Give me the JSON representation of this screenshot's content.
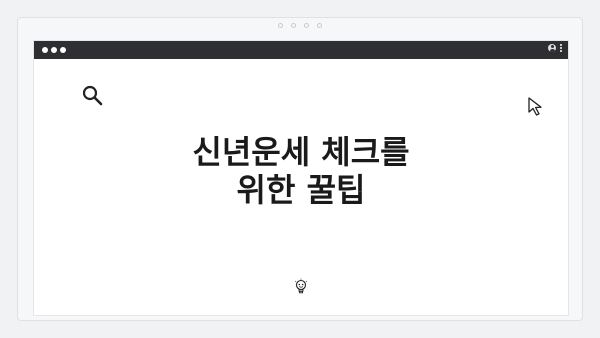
{
  "headline": {
    "line1": "신년운세 체크를",
    "line2": "위한 꿀팁"
  },
  "icons": {
    "search": "search-icon",
    "cursor": "cursor-arrow-icon",
    "lightbulb": "lightbulb-icon",
    "user": "user-icon",
    "menu": "more-vertical-icon"
  },
  "colors": {
    "titlebar": "#2f2f33",
    "background": "#f1f2f4",
    "text": "#1a1a1a"
  }
}
